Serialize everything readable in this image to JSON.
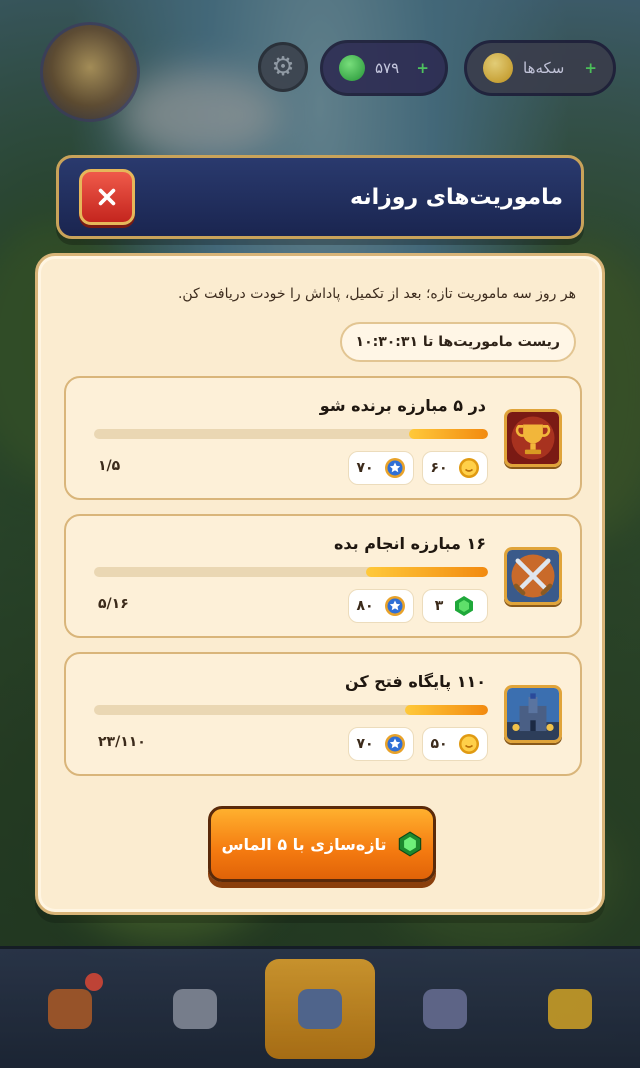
{
  "hud": {
    "gems_value": "۵۷۹",
    "coins_label": "سکه‌ها"
  },
  "modal": {
    "title": "ماموریت‌های روزانه",
    "subtitle": "هر روز سه ماموریت تازه؛ بعد از تکمیل، پاداش را خودت دریافت کن.",
    "reset_text": "ریست ماموریت‌ها تا ۱۰:۳۰:۳۱"
  },
  "quests": [
    {
      "title": "در ۵ مبارزه برنده شو",
      "icon": "trophy-icon",
      "progress_text": "۱/۵",
      "progress": 0.2,
      "rewards": [
        {
          "icon": "coin-icon",
          "value": "۶۰"
        },
        {
          "icon": "xp-medal-icon",
          "value": "۷۰"
        }
      ]
    },
    {
      "title": "۱۶ مبارزه انجام بده",
      "icon": "crossed-swords-icon",
      "progress_text": "۵/۱۶",
      "progress": 0.31,
      "rewards": [
        {
          "icon": "gem-icon",
          "value": "۳"
        },
        {
          "icon": "xp-medal-icon",
          "value": "۸۰"
        }
      ]
    },
    {
      "title": "۱۱۰ پایگاه فتح کن",
      "icon": "castle-icon",
      "progress_text": "۲۳/۱۱۰",
      "progress": 0.21,
      "rewards": [
        {
          "icon": "coin-icon",
          "value": "۵۰"
        },
        {
          "icon": "xp-medal-icon",
          "value": "۷۰"
        }
      ]
    }
  ],
  "refresh_button": {
    "label": "تازه‌سازی با ۵ الماس",
    "icon": "gem-icon"
  },
  "bottom_nav": [
    {
      "icon": "shop-chest-icon",
      "has_badge": true
    },
    {
      "icon": "swords-icon"
    },
    {
      "icon": "home-castle-icon",
      "active": true
    },
    {
      "icon": "tent-icon"
    },
    {
      "icon": "cards-icon"
    }
  ],
  "colors": {
    "header_bg": "#1a2550",
    "panel_bg": "#fbecd0",
    "accent_orange": "#f47a10",
    "close_red": "#d9362a"
  }
}
